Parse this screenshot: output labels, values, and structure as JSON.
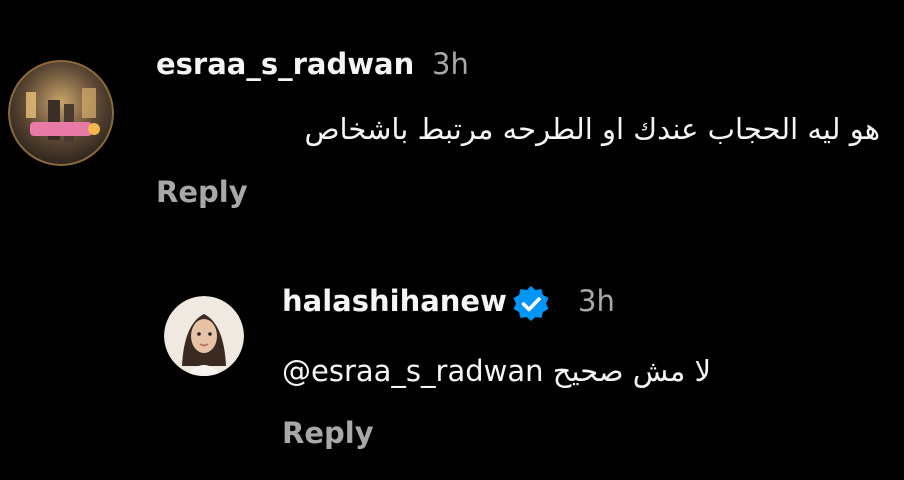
{
  "colors": {
    "background": "#000000",
    "primary_text": "#f5f5f5",
    "secondary_text": "#a8a8a8",
    "verified_badge": "#0095f6"
  },
  "comments": [
    {
      "username": "esraa_s_radwan",
      "time": "3h",
      "text": "هو ليه الحجاب عندك او الطرحه مرتبط باشخاص",
      "reply_label": "Reply",
      "avatar_icon": "profile-photo"
    },
    {
      "username": "halashihanew",
      "verified": true,
      "verified_icon": "verified-badge-icon",
      "time": "3h",
      "mention": "@esraa_s_radwan",
      "text": "لا مش صحيح",
      "reply_label": "Reply",
      "avatar_icon": "profile-photo"
    }
  ]
}
